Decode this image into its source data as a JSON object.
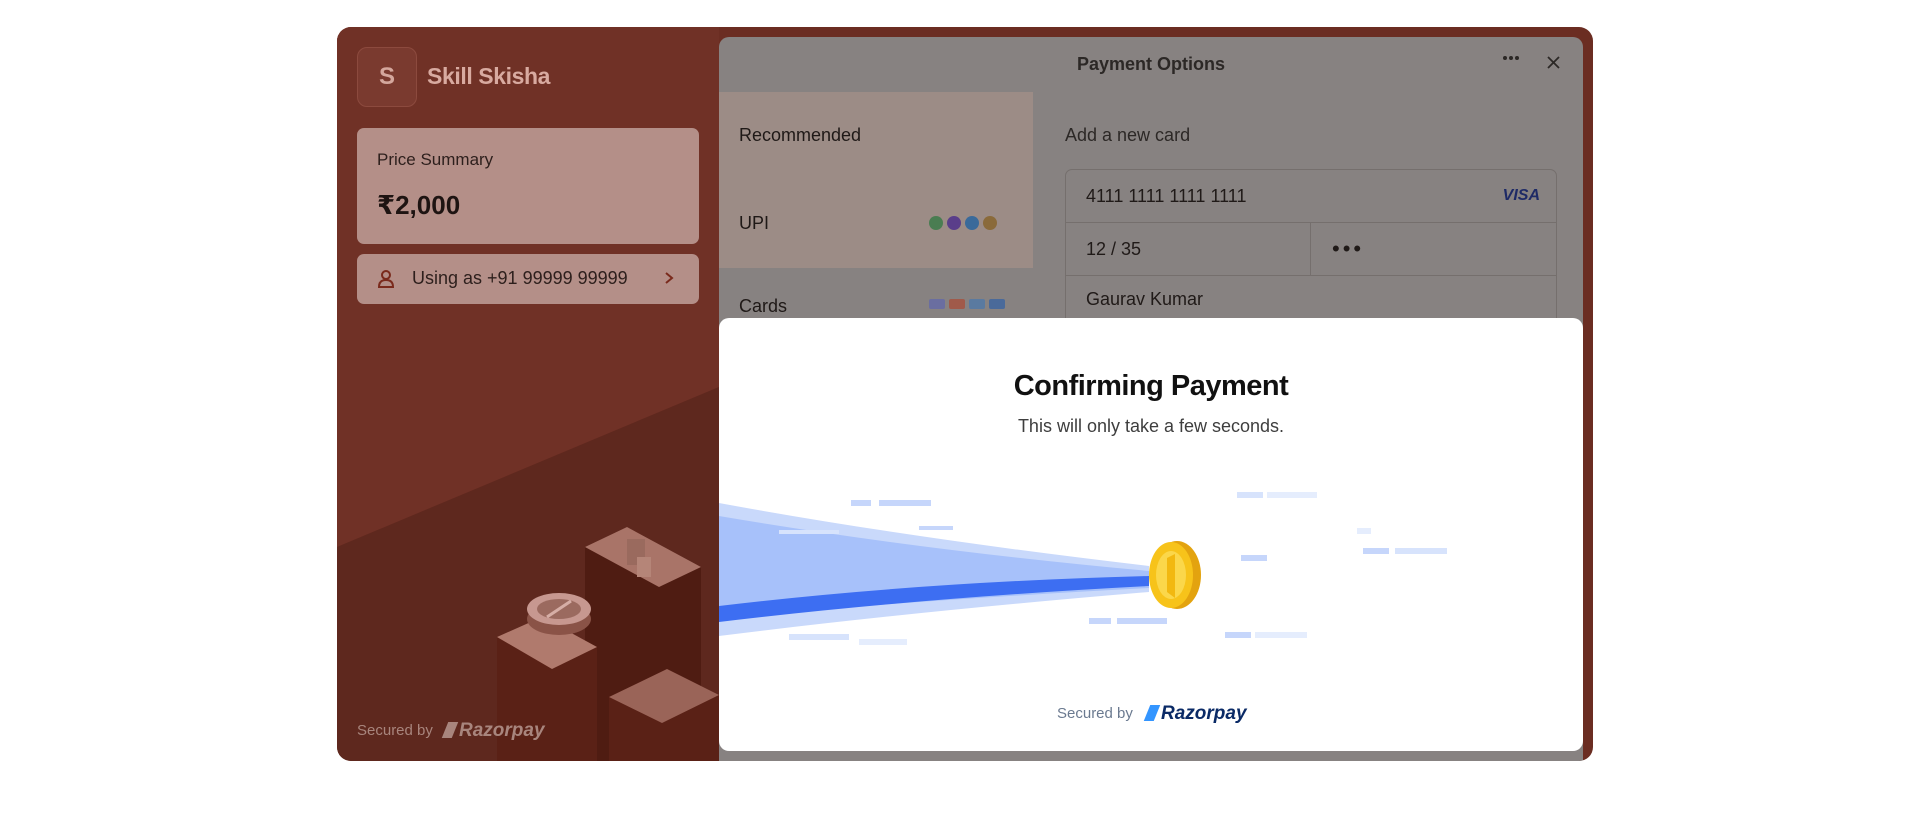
{
  "brand": {
    "initial": "S",
    "name": "Skill Skisha"
  },
  "price_summary": {
    "label": "Price Summary",
    "amount": "₹2,000"
  },
  "account": {
    "text": "Using as +91 99999 99999"
  },
  "secured": {
    "text": "Secured by",
    "provider": "Razorpay"
  },
  "payment_options": {
    "title": "Payment Options",
    "methods": [
      {
        "label": "Recommended"
      },
      {
        "label": "UPI"
      },
      {
        "label": "Cards"
      }
    ],
    "add_card": {
      "title": "Add a new card",
      "card_number": "4111 1111 1111 1111",
      "network": "VISA",
      "expiry": "12 / 35",
      "cvv": "•••",
      "name": "Gaurav Kumar"
    }
  },
  "overlay": {
    "title": "Confirming Payment",
    "subtitle": "This will only take a few seconds."
  },
  "colors": {
    "brand_dark": "#6b2d22",
    "razorpay_blue": "#0a2a66",
    "coin": "#f7c31a",
    "stream_blue": "#3d6ef2"
  }
}
